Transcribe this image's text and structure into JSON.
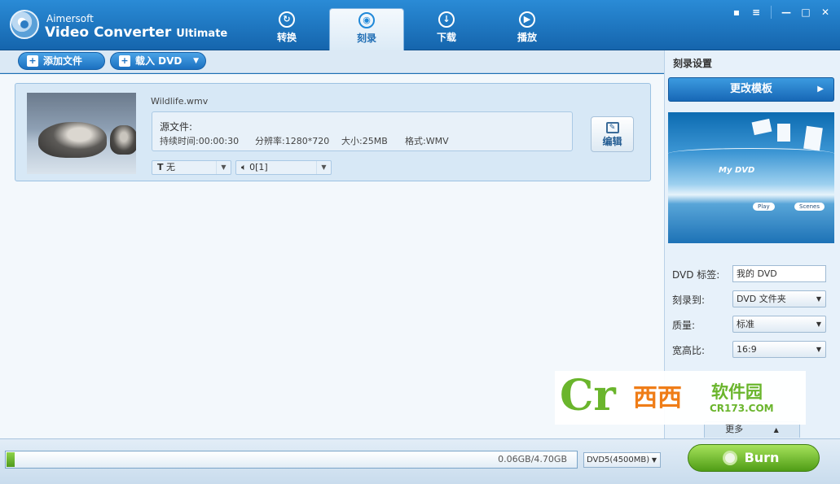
{
  "app": {
    "vendor": "Aimersoft",
    "product": "Video Converter",
    "edition": "Ultimate"
  },
  "tabs": [
    {
      "label": "转换",
      "icon": "refresh-icon"
    },
    {
      "label": "刻录",
      "icon": "disc-icon"
    },
    {
      "label": "下载",
      "icon": "download-icon"
    },
    {
      "label": "播放",
      "icon": "play-icon"
    }
  ],
  "active_tab": "刻录",
  "window_controls": [
    "chat-icon",
    "menu-icon",
    "minimize-icon",
    "maximize-icon",
    "close-icon"
  ],
  "toolbar": {
    "add_file": "添加文件",
    "load_dvd": "载入 DVD"
  },
  "file": {
    "name": "Wildlife.wmv",
    "source_label": "源文件:",
    "duration": "持续时间:00:00:30",
    "resolution": "分辨率:1280*720",
    "size": "大小:25MB",
    "format": "格式:WMV",
    "edit_label": "编辑",
    "subtitle_value": "无",
    "audio_value": "0[1]"
  },
  "burn_settings": {
    "title": "刻录设置",
    "change_template": "更改模板",
    "preview_title": "My DVD",
    "preview_play": "Play",
    "preview_scenes": "Scenes",
    "dvd_label_label": "DVD 标签:",
    "dvd_label_value": "我的 DVD",
    "burn_to_label": "刻录到:",
    "burn_to_value": "DVD 文件夹",
    "quality_label": "质量:",
    "quality_value": "标准",
    "aspect_label": "宽高比:",
    "aspect_value": "16:9",
    "more_label": "更多"
  },
  "watermark": {
    "logo": "Cr",
    "name1": "西西",
    "name2": "软件园",
    "url": "CR173.COM"
  },
  "bottom": {
    "capacity": "0.06GB/4.70GB",
    "used_fraction": 0.013,
    "disc_type": "DVD5(4500MB)",
    "burn_label": "Burn"
  },
  "colors": {
    "accent_blue": "#1b70c0",
    "burn_green": "#5aa91d"
  }
}
